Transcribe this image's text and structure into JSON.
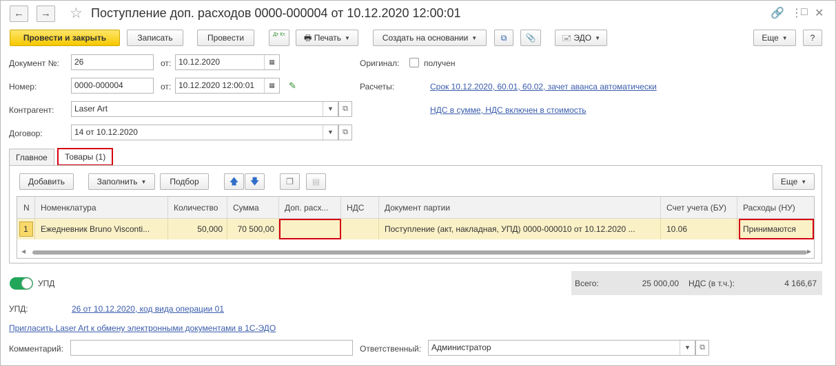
{
  "window": {
    "title": "Поступление доп. расходов 0000-000004 от 10.12.2020 12:00:01",
    "back_glyph": "←",
    "forward_glyph": "→",
    "star_glyph": "☆",
    "link_glyph": "🔗",
    "menu_glyph": "⋮",
    "maximize_glyph": "□",
    "close_glyph": "✕"
  },
  "toolbar": {
    "post_close": "Провести и закрыть",
    "save": "Записать",
    "post": "Провести",
    "dtkt": "Дт Кт",
    "print": "Печать",
    "create_based": "Создать на основании",
    "edo": "ЭДО",
    "more": "Еще",
    "help": "?"
  },
  "form": {
    "doc_no_label": "Документ №:",
    "doc_no_value": "26",
    "from_label": "от:",
    "doc_date": "10.12.2020",
    "number_label": "Номер:",
    "number_value": "0000-000004",
    "number_date": "10.12.2020 12:00:01",
    "contractor_label": "Контрагент:",
    "contractor_value": "Laser Art",
    "contract_label": "Договор:",
    "contract_value": "14 от 10.12.2020",
    "original_label": "Оригинал:",
    "received_label": "получен",
    "calc_label": "Расчеты:",
    "calc_link": "Срок 10.12.2020, 60.01, 60.02, зачет аванса автоматически",
    "vat_link": "НДС в сумме, НДС включен в стоимость"
  },
  "tabs": [
    {
      "label": "Главное"
    },
    {
      "label": "Товары (1)"
    }
  ],
  "table_toolbar": {
    "add": "Добавить",
    "fill": "Заполнить",
    "pick": "Подбор",
    "more": "Еще"
  },
  "table": {
    "headers": [
      "N",
      "Номенклатура",
      "Количество",
      "Сумма",
      "Доп. расх...",
      "НДС",
      "Документ партии",
      "Счет учета (БУ)",
      "Расходы (НУ)"
    ],
    "rows": [
      {
        "n": "1",
        "item": "Ежедневник Bruno Visconti...",
        "qty": "50,000",
        "sum": "70 500,00",
        "extra": "",
        "vat": "",
        "batch_doc": "Поступление (акт, накладная, УПД) 0000-000010 от 10.12.2020 ...",
        "account": "10.06",
        "expenses": "Принимаются"
      }
    ]
  },
  "upd_toggle_label": "УПД",
  "totals": {
    "total_label": "Всего:",
    "total_value": "25 000,00",
    "vat_label": "НДС (в т.ч.):",
    "vat_value": "4 166,67"
  },
  "upd": {
    "label": "УПД:",
    "link": "26 от 10.12.2020, код вида операции 01"
  },
  "invite_link": "Пригласить Laser Art к обмену электронными документами в 1С-ЭДО",
  "footer": {
    "comment_label": "Комментарий:",
    "comment_value": "",
    "responsible_label": "Ответственный:",
    "responsible_value": "Администратор"
  },
  "colors": {
    "primary_button": "#f6c800",
    "highlight_outline": "#d4000f",
    "selected_row": "#fbf1c7",
    "link": "#3a5cab",
    "toggle_on": "#22a65a"
  }
}
